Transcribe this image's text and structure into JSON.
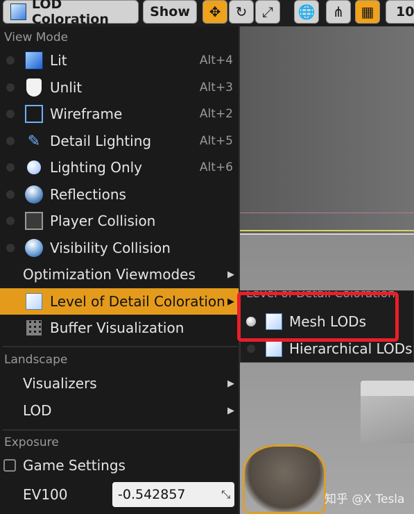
{
  "toolbar": {
    "lod_label": "LOD Coloration",
    "show_label": "Show",
    "camera_speed": "10"
  },
  "menu": {
    "view_mode_header": "View Mode",
    "items": [
      {
        "label": "Lit",
        "shortcut": "Alt+4"
      },
      {
        "label": "Unlit",
        "shortcut": "Alt+3"
      },
      {
        "label": "Wireframe",
        "shortcut": "Alt+2"
      },
      {
        "label": "Detail Lighting",
        "shortcut": "Alt+5"
      },
      {
        "label": "Lighting Only",
        "shortcut": "Alt+6"
      },
      {
        "label": "Reflections",
        "shortcut": ""
      },
      {
        "label": "Player Collision",
        "shortcut": ""
      },
      {
        "label": "Visibility Collision",
        "shortcut": ""
      },
      {
        "label": "Optimization Viewmodes",
        "shortcut": ""
      },
      {
        "label": "Level of Detail Coloration",
        "shortcut": ""
      },
      {
        "label": "Buffer Visualization",
        "shortcut": ""
      }
    ],
    "landscape_header": "Landscape",
    "landscape_items": [
      {
        "label": "Visualizers"
      },
      {
        "label": "LOD"
      }
    ],
    "exposure_header": "Exposure",
    "game_settings_label": "Game Settings",
    "game_settings_checked": false,
    "ev100_label": "EV100",
    "ev100_value": "-0.542857"
  },
  "submenu": {
    "title": "Level of Detail Coloration",
    "items": [
      {
        "label": "Mesh LODs",
        "selected": true
      },
      {
        "label": "Hierarchical LODs",
        "selected": false
      }
    ]
  },
  "watermark": "知乎 @X Tesla",
  "colors": {
    "highlight": "#e49b1b",
    "annotation_box": "#ea1e2a",
    "menu_bg": "#1a1a1a"
  }
}
